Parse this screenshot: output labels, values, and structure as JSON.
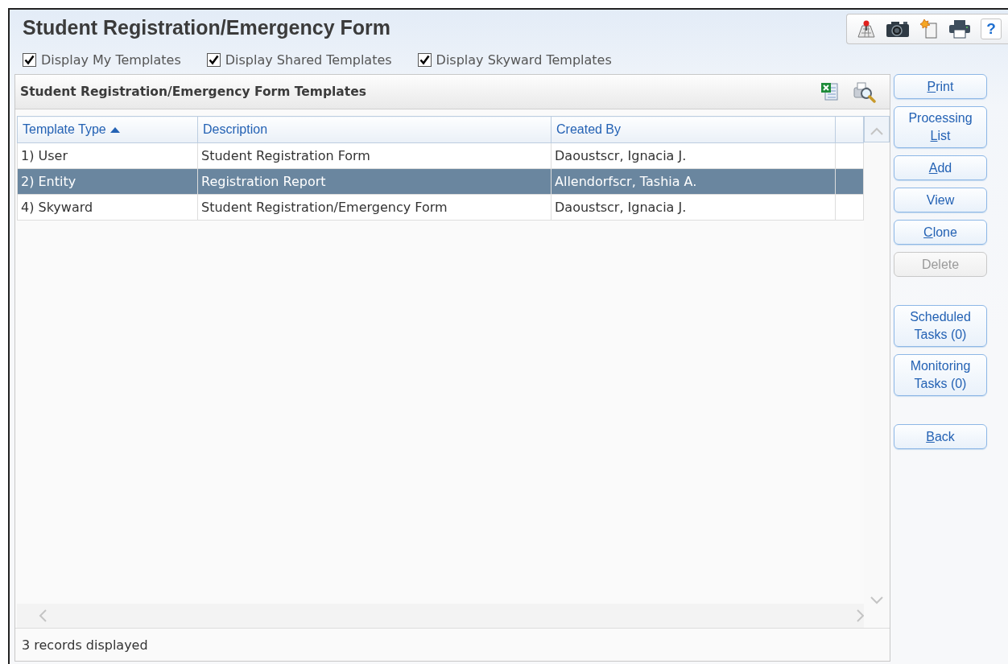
{
  "window": {
    "title": "Student Registration/Emergency Form"
  },
  "toolbar": [
    {
      "kind": "map"
    },
    {
      "kind": "camera"
    },
    {
      "kind": "note"
    },
    {
      "kind": "print"
    },
    {
      "kind": "help",
      "label": "?"
    }
  ],
  "filters": [
    {
      "label": "Display My Templates",
      "checked": true
    },
    {
      "label": "Display Shared Templates",
      "checked": true
    },
    {
      "label": "Display Skyward Templates",
      "checked": true
    }
  ],
  "panel": {
    "title": "Student Registration/Emergency Form Templates",
    "table": {
      "columns": [
        {
          "label": "Template Type",
          "sorted": true
        },
        {
          "label": "Description",
          "sorted": false
        },
        {
          "label": "Created By",
          "sorted": false
        }
      ],
      "rows": [
        {
          "cells": [
            "1) User",
            "Student Registration Form",
            "Daoustscr, Ignacia J."
          ],
          "selected": false
        },
        {
          "cells": [
            "2) Entity",
            "Registration Report",
            "Allendorfscr, Tashia A."
          ],
          "selected": true
        },
        {
          "cells": [
            "4) Skyward",
            "Student Registration/Emergency Form",
            "Daoustscr, Ignacia J."
          ],
          "selected": false
        }
      ]
    },
    "status": "3 records displayed"
  },
  "button_groups": [
    [
      {
        "key": "P",
        "after": "rint",
        "disabled": false
      },
      {
        "before": "Processing ",
        "key": "L",
        "after": "ist",
        "disabled": false
      },
      {
        "key": "A",
        "after": "dd",
        "disabled": false
      },
      {
        "before": "View",
        "disabled": false
      },
      {
        "key": "C",
        "after": "lone",
        "disabled": false
      },
      {
        "before": "Delete",
        "disabled": true
      }
    ],
    [
      {
        "before": "Scheduled Tasks (0)",
        "disabled": false
      },
      {
        "before": "Monitoring Tasks (0)",
        "disabled": false
      }
    ],
    [
      {
        "key": "B",
        "after": "ack",
        "disabled": false
      }
    ]
  ]
}
